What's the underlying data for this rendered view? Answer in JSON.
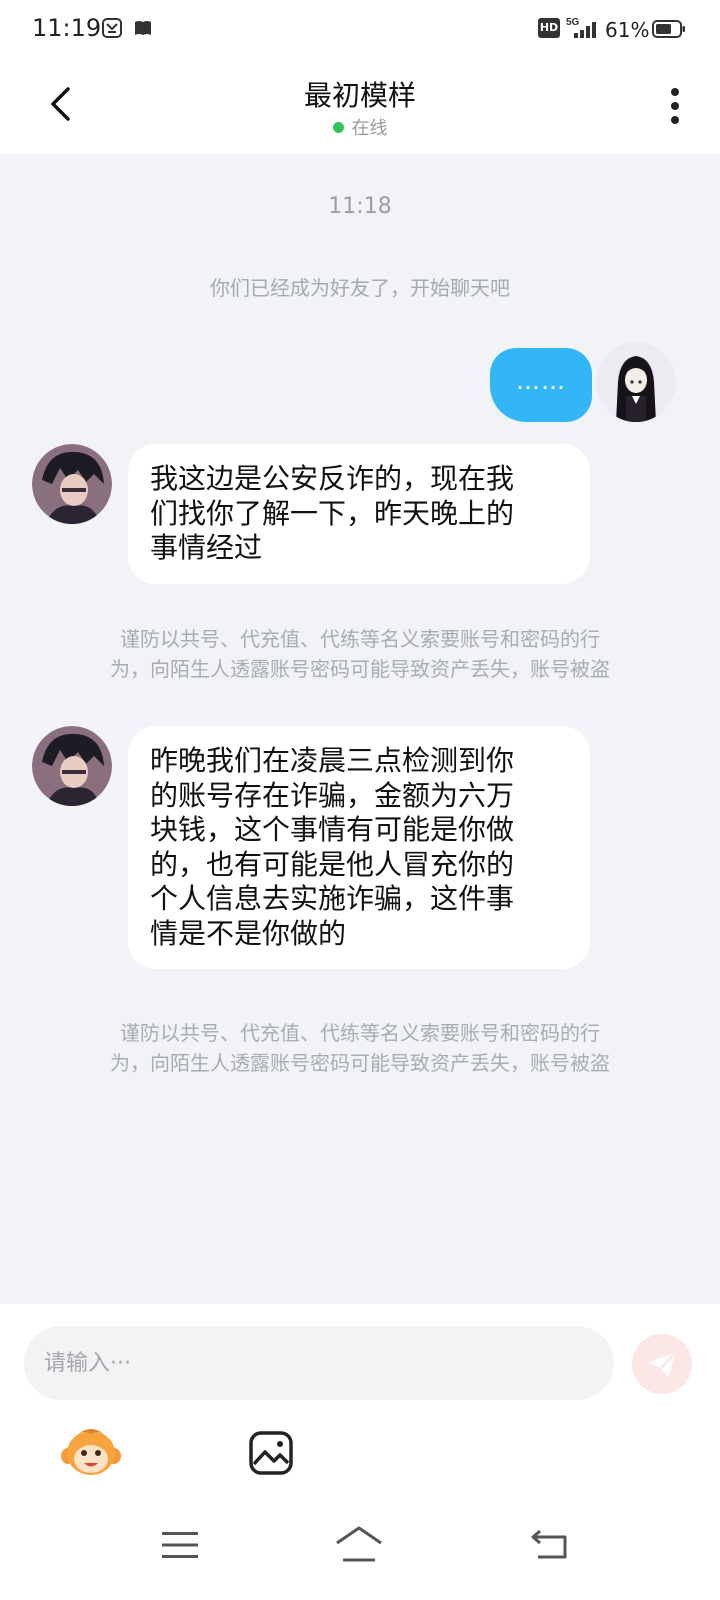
{
  "status_bar": {
    "time": "11:19",
    "hd": "HD",
    "network": "5G",
    "battery": "61%"
  },
  "header": {
    "title": "最初模样",
    "status": "在线"
  },
  "chat": {
    "timestamp": "11:18",
    "system_message": "你们已经成为好友了，开始聊天吧",
    "outgoing": {
      "text": "……"
    },
    "incoming": [
      {
        "lines": [
          "我这边是公安反诈的，现在我",
          "们找你了解一下，昨天晚上的",
          "事情经过"
        ],
        "warning": [
          "谨防以共号、代充值、代练等名义索要账号和密码的行",
          "为，向陌生人透露账号密码可能导致资产丢失，账号被盗"
        ]
      },
      {
        "lines": [
          "昨晚我们在凌晨三点检测到你",
          "的账号存在诈骗，金额为六万",
          "块钱，这个事情有可能是你做",
          "的，也有可能是他人冒充你的",
          "个人信息去实施诈骗，这件事",
          "情是不是你做的"
        ],
        "warning": [
          "谨防以共号、代充值、代练等名义索要账号和密码的行",
          "为，向陌生人透露账号密码可能导致资产丢失，账号被盗"
        ]
      }
    ]
  },
  "composer": {
    "placeholder": "请输入···"
  },
  "colors": {
    "accent_blue": "#32b6f7",
    "online_green": "#2fc55b",
    "chat_bg": "#f1f3f7",
    "send_button": "#fde7e6"
  },
  "icons": {
    "back": "chevron-left-icon",
    "more": "more-vertical-icon",
    "send": "paper-plane-icon",
    "emoji": "monkey-emoji-icon",
    "image": "image-icon",
    "nav_menu": "menu-icon",
    "nav_home": "home-icon",
    "nav_back": "back-icon"
  }
}
